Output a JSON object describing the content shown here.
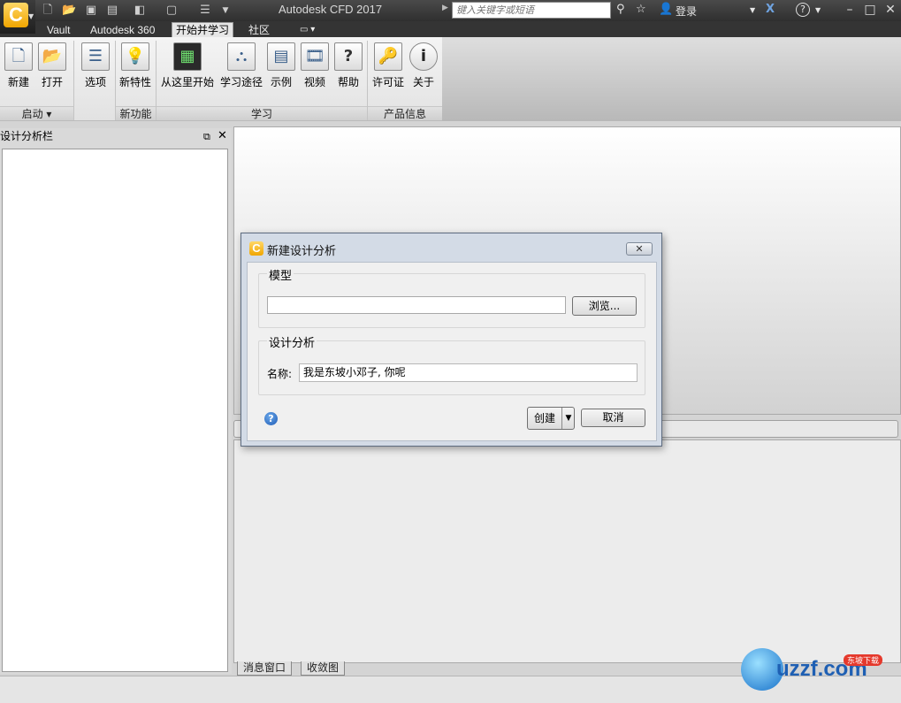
{
  "app": {
    "title": "Autodesk CFD 2017",
    "search_placeholder": "键入关键字或短语",
    "login_label": "登录",
    "help_label": "?",
    "minimize": "–",
    "maximize": "□",
    "close": "✕"
  },
  "qat": {
    "icons": [
      "new-file-icon",
      "open-folder-icon",
      "save-icon",
      "save-as-icon",
      "cube-icon",
      "cube2-icon",
      "options-icon"
    ]
  },
  "tabs": [
    {
      "label": "Vault"
    },
    {
      "label": "Autodesk 360"
    },
    {
      "label": "开始并学习"
    },
    {
      "label": "社区"
    }
  ],
  "ribbon": {
    "buttons": [
      {
        "label": "新建",
        "icon": "new-document-icon"
      },
      {
        "label": "打开",
        "icon": "open-folder-icon"
      },
      {
        "label": "选项",
        "icon": "options-list-icon"
      },
      {
        "label": "新特性",
        "icon": "lightbulb-icon"
      },
      {
        "label": "从这里开始",
        "icon": "start-here-icon"
      },
      {
        "label": "学习途径",
        "icon": "learning-path-icon"
      },
      {
        "label": "示例",
        "icon": "examples-icon"
      },
      {
        "label": "视频",
        "icon": "video-icon"
      },
      {
        "label": "帮助",
        "icon": "help-icon"
      },
      {
        "label": "许可证",
        "icon": "key-icon"
      },
      {
        "label": "关于",
        "icon": "info-icon"
      }
    ],
    "groups": [
      {
        "label": "启动 ▾"
      },
      {
        "label": "新功能"
      },
      {
        "label": "学习"
      },
      {
        "label": "产品信息"
      }
    ]
  },
  "left_panel": {
    "title": "设计分析栏"
  },
  "bottom_tabs": [
    {
      "label": "消息窗口"
    },
    {
      "label": "收敛图"
    }
  ],
  "dialog": {
    "title": "新建设计分析",
    "model_group": "模型",
    "model_value": "",
    "browse_label": "浏览...",
    "design_group": "设计分析",
    "name_label": "名称:",
    "name_value": "我是东坡小邓子, 你呢",
    "create_label": "创建",
    "cancel_label": "取消",
    "close_label": "✕"
  },
  "watermark": {
    "text": "uzzf.com",
    "badge": "东坡下载"
  }
}
